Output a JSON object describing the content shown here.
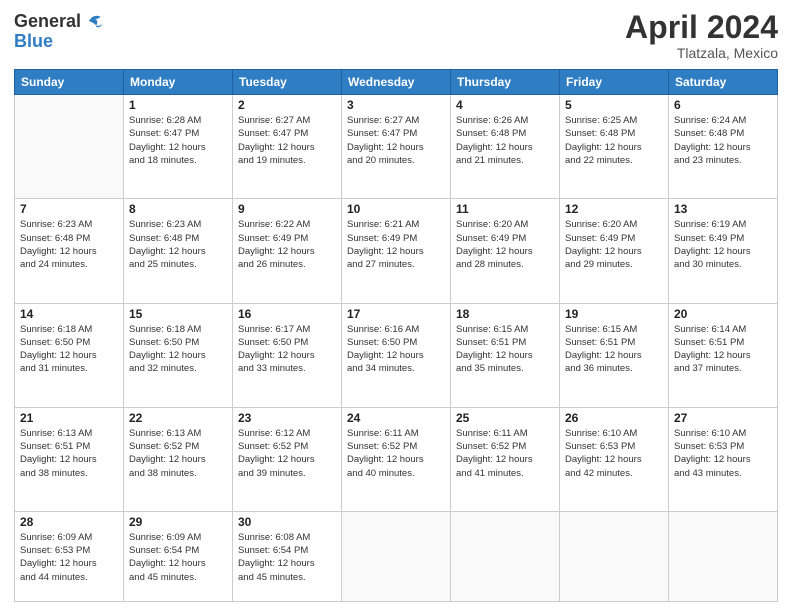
{
  "header": {
    "logo_text_general": "General",
    "logo_text_blue": "Blue",
    "main_title": "April 2024",
    "subtitle": "Tlatzala, Mexico"
  },
  "calendar": {
    "days_of_week": [
      "Sunday",
      "Monday",
      "Tuesday",
      "Wednesday",
      "Thursday",
      "Friday",
      "Saturday"
    ],
    "weeks": [
      [
        {
          "day": "",
          "info": ""
        },
        {
          "day": "1",
          "info": "Sunrise: 6:28 AM\nSunset: 6:47 PM\nDaylight: 12 hours\nand 18 minutes."
        },
        {
          "day": "2",
          "info": "Sunrise: 6:27 AM\nSunset: 6:47 PM\nDaylight: 12 hours\nand 19 minutes."
        },
        {
          "day": "3",
          "info": "Sunrise: 6:27 AM\nSunset: 6:47 PM\nDaylight: 12 hours\nand 20 minutes."
        },
        {
          "day": "4",
          "info": "Sunrise: 6:26 AM\nSunset: 6:48 PM\nDaylight: 12 hours\nand 21 minutes."
        },
        {
          "day": "5",
          "info": "Sunrise: 6:25 AM\nSunset: 6:48 PM\nDaylight: 12 hours\nand 22 minutes."
        },
        {
          "day": "6",
          "info": "Sunrise: 6:24 AM\nSunset: 6:48 PM\nDaylight: 12 hours\nand 23 minutes."
        }
      ],
      [
        {
          "day": "7",
          "info": "Sunrise: 6:23 AM\nSunset: 6:48 PM\nDaylight: 12 hours\nand 24 minutes."
        },
        {
          "day": "8",
          "info": "Sunrise: 6:23 AM\nSunset: 6:48 PM\nDaylight: 12 hours\nand 25 minutes."
        },
        {
          "day": "9",
          "info": "Sunrise: 6:22 AM\nSunset: 6:49 PM\nDaylight: 12 hours\nand 26 minutes."
        },
        {
          "day": "10",
          "info": "Sunrise: 6:21 AM\nSunset: 6:49 PM\nDaylight: 12 hours\nand 27 minutes."
        },
        {
          "day": "11",
          "info": "Sunrise: 6:20 AM\nSunset: 6:49 PM\nDaylight: 12 hours\nand 28 minutes."
        },
        {
          "day": "12",
          "info": "Sunrise: 6:20 AM\nSunset: 6:49 PM\nDaylight: 12 hours\nand 29 minutes."
        },
        {
          "day": "13",
          "info": "Sunrise: 6:19 AM\nSunset: 6:49 PM\nDaylight: 12 hours\nand 30 minutes."
        }
      ],
      [
        {
          "day": "14",
          "info": "Sunrise: 6:18 AM\nSunset: 6:50 PM\nDaylight: 12 hours\nand 31 minutes."
        },
        {
          "day": "15",
          "info": "Sunrise: 6:18 AM\nSunset: 6:50 PM\nDaylight: 12 hours\nand 32 minutes."
        },
        {
          "day": "16",
          "info": "Sunrise: 6:17 AM\nSunset: 6:50 PM\nDaylight: 12 hours\nand 33 minutes."
        },
        {
          "day": "17",
          "info": "Sunrise: 6:16 AM\nSunset: 6:50 PM\nDaylight: 12 hours\nand 34 minutes."
        },
        {
          "day": "18",
          "info": "Sunrise: 6:15 AM\nSunset: 6:51 PM\nDaylight: 12 hours\nand 35 minutes."
        },
        {
          "day": "19",
          "info": "Sunrise: 6:15 AM\nSunset: 6:51 PM\nDaylight: 12 hours\nand 36 minutes."
        },
        {
          "day": "20",
          "info": "Sunrise: 6:14 AM\nSunset: 6:51 PM\nDaylight: 12 hours\nand 37 minutes."
        }
      ],
      [
        {
          "day": "21",
          "info": "Sunrise: 6:13 AM\nSunset: 6:51 PM\nDaylight: 12 hours\nand 38 minutes."
        },
        {
          "day": "22",
          "info": "Sunrise: 6:13 AM\nSunset: 6:52 PM\nDaylight: 12 hours\nand 38 minutes."
        },
        {
          "day": "23",
          "info": "Sunrise: 6:12 AM\nSunset: 6:52 PM\nDaylight: 12 hours\nand 39 minutes."
        },
        {
          "day": "24",
          "info": "Sunrise: 6:11 AM\nSunset: 6:52 PM\nDaylight: 12 hours\nand 40 minutes."
        },
        {
          "day": "25",
          "info": "Sunrise: 6:11 AM\nSunset: 6:52 PM\nDaylight: 12 hours\nand 41 minutes."
        },
        {
          "day": "26",
          "info": "Sunrise: 6:10 AM\nSunset: 6:53 PM\nDaylight: 12 hours\nand 42 minutes."
        },
        {
          "day": "27",
          "info": "Sunrise: 6:10 AM\nSunset: 6:53 PM\nDaylight: 12 hours\nand 43 minutes."
        }
      ],
      [
        {
          "day": "28",
          "info": "Sunrise: 6:09 AM\nSunset: 6:53 PM\nDaylight: 12 hours\nand 44 minutes."
        },
        {
          "day": "29",
          "info": "Sunrise: 6:09 AM\nSunset: 6:54 PM\nDaylight: 12 hours\nand 45 minutes."
        },
        {
          "day": "30",
          "info": "Sunrise: 6:08 AM\nSunset: 6:54 PM\nDaylight: 12 hours\nand 45 minutes."
        },
        {
          "day": "",
          "info": ""
        },
        {
          "day": "",
          "info": ""
        },
        {
          "day": "",
          "info": ""
        },
        {
          "day": "",
          "info": ""
        }
      ]
    ]
  }
}
